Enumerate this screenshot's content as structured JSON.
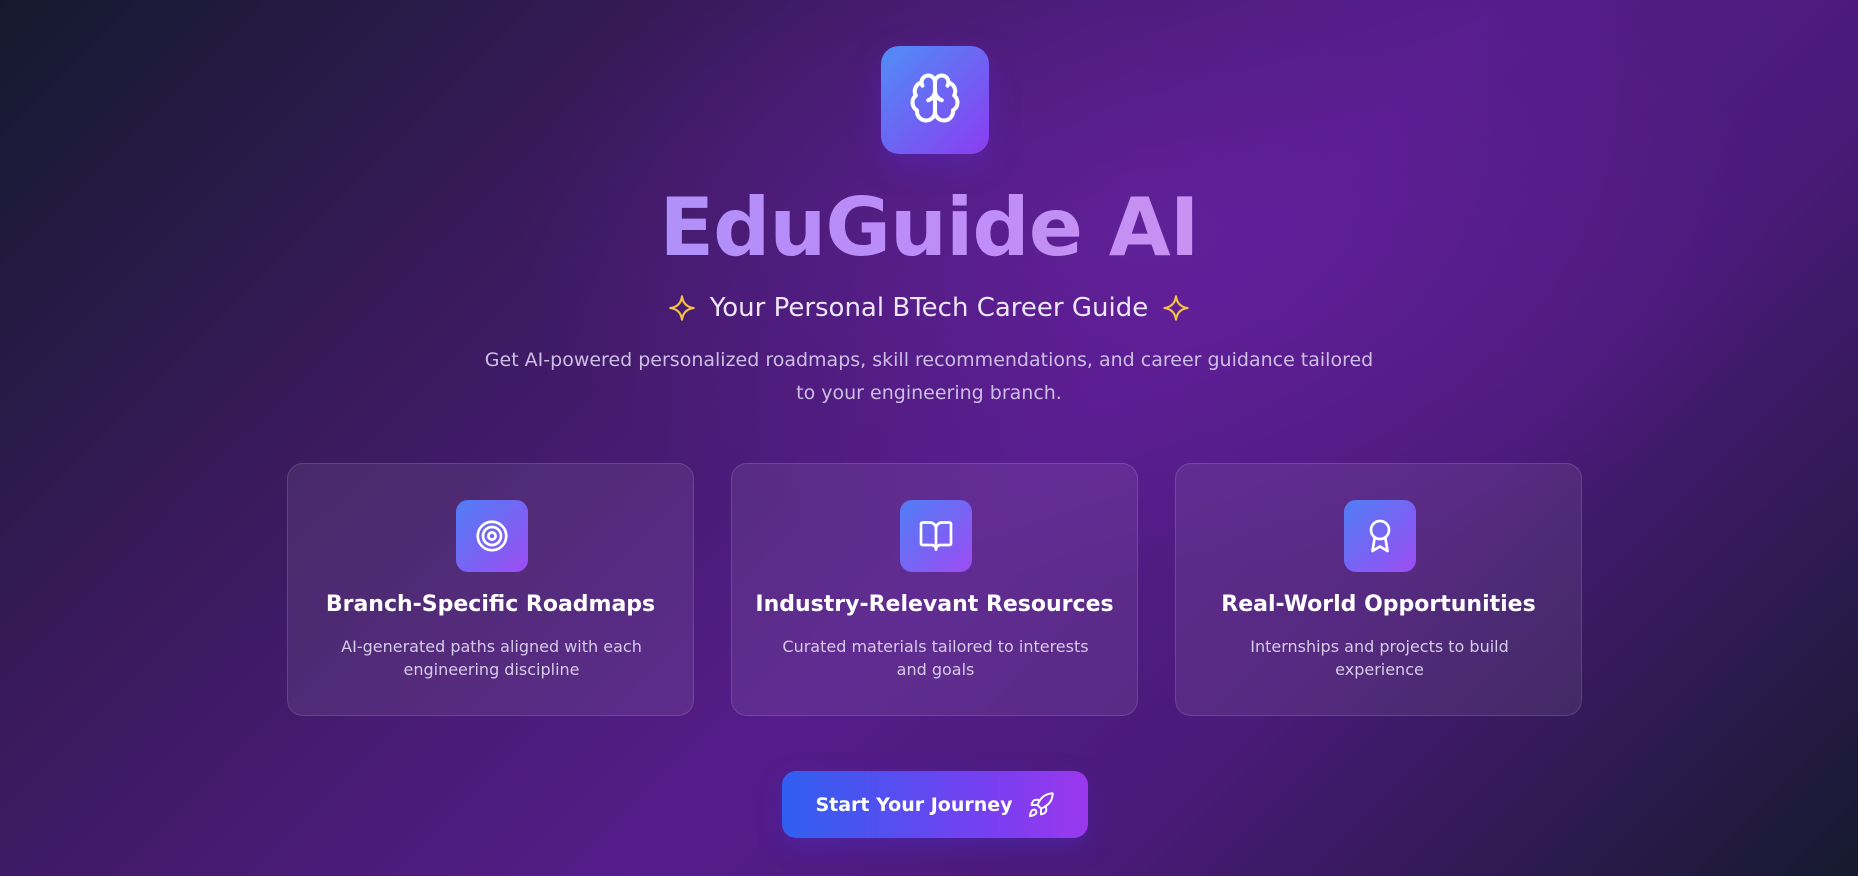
{
  "hero": {
    "logo_icon": "brain-icon",
    "title": "EduGuide AI",
    "tagline": "Your Personal BTech Career Guide",
    "tagline_icon": "sparkle-icon",
    "description": "Get AI-powered personalized roadmaps, skill recommendations, and career guidance tailored to your engineering branch."
  },
  "features": [
    {
      "icon": "target-icon",
      "title": "Branch-Specific Roadmaps",
      "text": "AI-generated paths aligned with each engineering discipline"
    },
    {
      "icon": "book-open-icon",
      "title": "Industry-Relevant Resources",
      "text": "Curated materials tailored to interests and goals"
    },
    {
      "icon": "award-icon",
      "title": "Real-World Opportunities",
      "text": "Internships and projects to build experience"
    }
  ],
  "cta": {
    "label": "Start Your Journey",
    "icon": "rocket-icon"
  },
  "colors": {
    "accent_blue": "#2f5ff0",
    "accent_purple": "#9b38ee",
    "sparkle_gold": "#f5c542",
    "title_gradient_start": "#8ea0ff",
    "title_gradient_end": "#e49be8"
  }
}
